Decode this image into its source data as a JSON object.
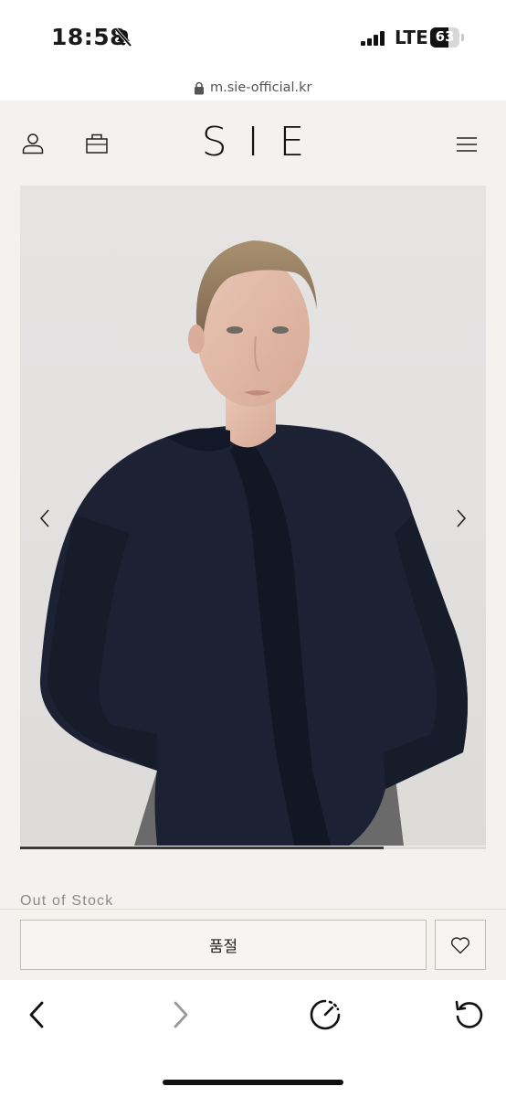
{
  "status_bar": {
    "time": "18:58",
    "network": "LTE",
    "battery": "63",
    "battery_level": 0.63
  },
  "browser": {
    "url": "m.sie-official.kr"
  },
  "header": {
    "logo": "SIE"
  },
  "product": {
    "gallery_progress": 0.78,
    "stock_status": "Out of Stock",
    "sold_out_label": "품절"
  },
  "icons": {
    "account": "person-icon",
    "cart": "shopping-bag-icon",
    "menu": "hamburger-menu-icon",
    "prev": "chevron-left-icon",
    "next": "chevron-right-icon",
    "wishlist": "heart-icon",
    "lock": "lock-icon",
    "bell_muted": "bell-slash-icon",
    "reload": "reload-icon",
    "speed": "speedometer-icon"
  },
  "colors": {
    "background": "#f3f2ee",
    "garment": "#1c2233",
    "accent": "#111111"
  }
}
